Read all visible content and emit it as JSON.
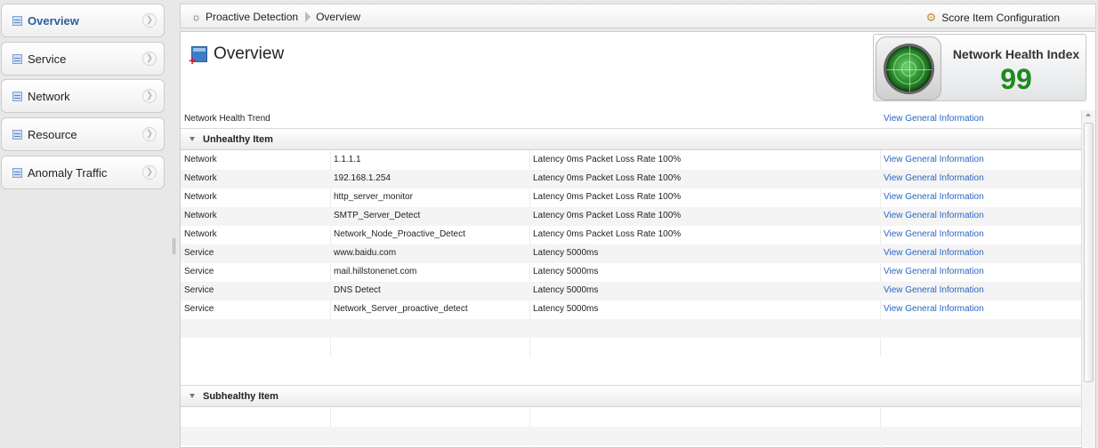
{
  "sidebar": {
    "items": [
      {
        "label": "Overview",
        "active": true
      },
      {
        "label": "Service",
        "active": false
      },
      {
        "label": "Network",
        "active": false
      },
      {
        "label": "Resource",
        "active": false
      },
      {
        "label": "Anomaly Traffic",
        "active": false
      }
    ]
  },
  "breadcrumb": {
    "root": "Proactive Detection",
    "current": "Overview"
  },
  "toolbar": {
    "config_label": "Score Item Configuration"
  },
  "header": {
    "title": "Overview",
    "nhi_label": "Network Health Index",
    "nhi_value": "99"
  },
  "table": {
    "trend_row": {
      "category": "Network Health Trend",
      "link": "View General Information"
    },
    "unhealthy": {
      "label": "Unhealthy Item",
      "rows": [
        {
          "category": "Network",
          "target": "1.1.1.1",
          "status": "Latency 0ms Packet Loss Rate 100%",
          "link": "View General Information"
        },
        {
          "category": "Network",
          "target": "192.168.1.254",
          "status": "Latency 0ms Packet Loss Rate 100%",
          "link": "View General Information"
        },
        {
          "category": "Network",
          "target": "http_server_monitor",
          "status": "Latency 0ms Packet Loss Rate 100%",
          "link": "View General Information"
        },
        {
          "category": "Network",
          "target": "SMTP_Server_Detect",
          "status": "Latency 0ms Packet Loss Rate 100%",
          "link": "View General Information"
        },
        {
          "category": "Network",
          "target": "Network_Node_Proactive_Detect",
          "status": "Latency 0ms Packet Loss Rate 100%",
          "link": "View General Information"
        },
        {
          "category": "Service",
          "target": "www.baidu.com",
          "status": "Latency 5000ms",
          "link": "View General Information"
        },
        {
          "category": "Service",
          "target": "mail.hillstonenet.com",
          "status": "Latency 5000ms",
          "link": "View General Information"
        },
        {
          "category": "Service",
          "target": "DNS Detect",
          "status": "Latency 5000ms",
          "link": "View General Information"
        },
        {
          "category": "Service",
          "target": "Network_Server_proactive_detect",
          "status": "Latency 5000ms",
          "link": "View General Information"
        }
      ]
    },
    "subhealthy": {
      "label": "Subhealthy Item"
    }
  },
  "colors": {
    "link": "#2a66c0",
    "nhi_value": "#1e8a1e",
    "active_nav": "#2c5f9e"
  },
  "icons": {
    "nav": "list-icon",
    "nav_chevron": "chevron-right-icon",
    "breadcrumb": "detection-icon",
    "config": "gear-icon",
    "overview": "overview-icon",
    "nhi": "radar-icon",
    "group": "chevron-down-icon"
  }
}
